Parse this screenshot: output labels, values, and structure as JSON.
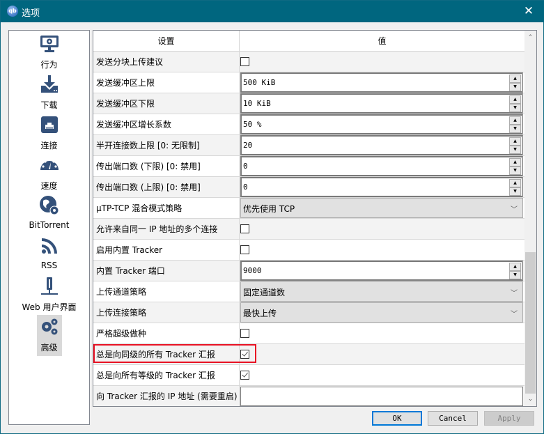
{
  "window": {
    "title": "选项",
    "app_icon_text": "qb",
    "close_glyph": "✕"
  },
  "sidebar": {
    "items": [
      {
        "label": "行为",
        "icon": "monitor-gear-icon"
      },
      {
        "label": "下载",
        "icon": "download-icon"
      },
      {
        "label": "连接",
        "icon": "ethernet-icon"
      },
      {
        "label": "速度",
        "icon": "speedometer-icon"
      },
      {
        "label": "BitTorrent",
        "icon": "globe-gear-icon"
      },
      {
        "label": "RSS",
        "icon": "rss-icon"
      },
      {
        "label": "Web 用户界面",
        "icon": "webui-icon"
      },
      {
        "label": "高级",
        "icon": "gears-icon",
        "active": true
      }
    ]
  },
  "table": {
    "headers": {
      "setting": "设置",
      "value": "值"
    },
    "rows": [
      {
        "name": "发送分块上传建议",
        "type": "checkbox",
        "checked": false
      },
      {
        "name": "发送缓冲区上限",
        "type": "spinbox",
        "value": "500 KiB"
      },
      {
        "name": "发送缓冲区下限",
        "type": "spinbox",
        "value": "10 KiB"
      },
      {
        "name": "发送缓冲区增长系数",
        "type": "spinbox",
        "value": "50 %"
      },
      {
        "name": "半开连接数上限 [0: 无限制]",
        "type": "spinbox",
        "value": "20"
      },
      {
        "name": "传出端口数 (下限) [0: 禁用]",
        "type": "spinbox",
        "value": "0"
      },
      {
        "name": "传出端口数 (上限) [0: 禁用]",
        "type": "spinbox",
        "value": "0"
      },
      {
        "name": "µTP-TCP 混合模式策略",
        "type": "combo",
        "value": "优先使用 TCP"
      },
      {
        "name": "允许来自同一 IP 地址的多个连接",
        "type": "checkbox",
        "checked": false
      },
      {
        "name": "启用内置 Tracker",
        "type": "checkbox",
        "checked": false
      },
      {
        "name": "内置 Tracker 端口",
        "type": "spinbox",
        "value": "9000"
      },
      {
        "name": "上传通道策略",
        "type": "combo",
        "value": "固定通道数"
      },
      {
        "name": "上传连接策略",
        "type": "combo",
        "value": "最快上传"
      },
      {
        "name": "严格超级做种",
        "type": "checkbox",
        "checked": false
      },
      {
        "name": "总是向同级的所有 Tracker 汇报",
        "type": "checkbox",
        "checked": true,
        "highlighted": true
      },
      {
        "name": "总是向所有等级的 Tracker 汇报",
        "type": "checkbox",
        "checked": true
      },
      {
        "name": "向 Tracker 汇报的 IP 地址 (需要重启)",
        "type": "text",
        "value": ""
      }
    ]
  },
  "scrollbar": {
    "up_glyph": "⌃",
    "down_glyph": "⌄",
    "position_percent": 100
  },
  "buttons": {
    "ok": "OK",
    "cancel": "Cancel",
    "apply": "Apply",
    "apply_enabled": false
  },
  "colors": {
    "titlebar": "#00667f",
    "highlight": "#e81123",
    "ok_border": "#0078d7"
  }
}
